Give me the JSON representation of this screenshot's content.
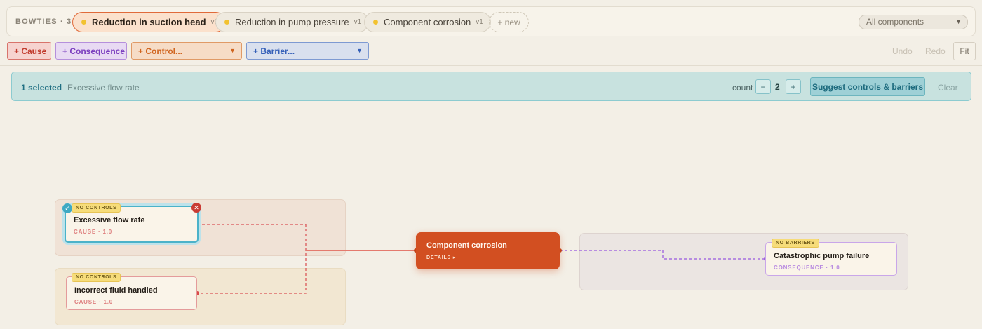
{
  "tabbar": {
    "title": "BOWTIES · 3",
    "tabs": [
      {
        "label": "Reduction in suction head",
        "version": "v1",
        "active": true
      },
      {
        "label": "Reduction in pump pressure",
        "version": "v1",
        "active": false
      },
      {
        "label": "Component corrosion",
        "version": "v1",
        "active": false
      }
    ],
    "new_label": "+ new",
    "filter": {
      "value": "All components"
    }
  },
  "toolbar": {
    "cause_label": "+ Cause",
    "consequence_label": "+ Consequence",
    "control_label": "+ Control...",
    "barrier_label": "+ Barrier...",
    "undo_label": "Undo",
    "redo_label": "Redo",
    "fit_label": "Fit"
  },
  "selection": {
    "count_text": "1 selected",
    "item_name": "Excessive flow rate",
    "count_label": "count",
    "decrement_label": "−",
    "count_value": "2",
    "increment_label": "+",
    "suggest_label": "Suggest controls & barriers",
    "clear_label": "Clear"
  },
  "diagram": {
    "causes": [
      {
        "badge": "NO CONTROLS",
        "title": "Excessive flow rate",
        "sub": "CAUSE · 1.0",
        "selected": true
      },
      {
        "badge": "NO CONTROLS",
        "title": "Incorrect fluid handled",
        "sub": "CAUSE · 1.0",
        "selected": false
      }
    ],
    "hazard": {
      "title": "Component corrosion",
      "details": "DETAILS ▸"
    },
    "consequences": [
      {
        "badge": "NO BARRIERS",
        "title": "Catastrophic pump failure",
        "sub": "CONSEQUENCE · 1.0"
      }
    ]
  },
  "colors": {
    "accent_hazard": "#d24f21",
    "cause": "#de5f5f",
    "consequence": "#a66ee0",
    "selection": "#4bb2c9",
    "badge": "#f6dc7a"
  }
}
